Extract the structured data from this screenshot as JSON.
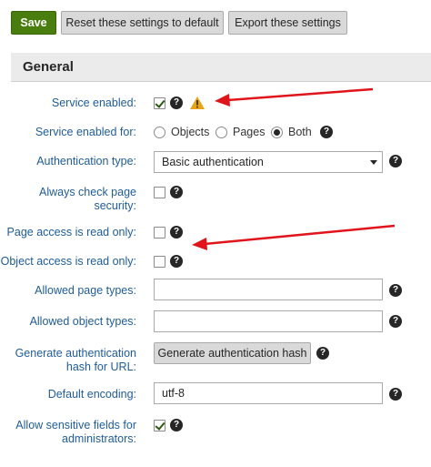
{
  "toolbar": {
    "save_label": "Save",
    "reset_label": "Reset these settings to default",
    "export_label": "Export these settings"
  },
  "section": {
    "title": "General"
  },
  "fields": {
    "service_enabled": {
      "label": "Service enabled:",
      "checked": true
    },
    "service_enabled_for": {
      "label": "Service enabled for:",
      "options": [
        "Objects",
        "Pages",
        "Both"
      ],
      "selected": "Both"
    },
    "authentication_type": {
      "label": "Authentication type:",
      "value": "Basic authentication"
    },
    "always_check_page_security": {
      "label_line1": "Always check page",
      "label_line2": "security:",
      "checked": false
    },
    "page_access_read_only": {
      "label": "Page access is read only:",
      "checked": false
    },
    "object_access_read_only": {
      "label": "Object access is read only:",
      "checked": false
    },
    "allowed_page_types": {
      "label": "Allowed page types:",
      "value": ""
    },
    "allowed_object_types": {
      "label": "Allowed object types:",
      "value": ""
    },
    "generate_auth_hash": {
      "label_line1": "Generate authentication",
      "label_line2": "hash for URL:",
      "button_label": "Generate authentication hash"
    },
    "default_encoding": {
      "label": "Default encoding:",
      "value": "utf-8"
    },
    "allow_sensitive_fields": {
      "label_line1": "Allow sensitive fields for",
      "label_line2": "administrators:",
      "checked": true
    }
  },
  "help_glyph": "?",
  "colors": {
    "primary_button": "#497d0d",
    "label_text": "#1f5c99",
    "annotation_arrow": "#e0141b",
    "warning": "#e8a317"
  },
  "icons": [
    "help-icon",
    "warning-icon",
    "annotation-arrow"
  ]
}
